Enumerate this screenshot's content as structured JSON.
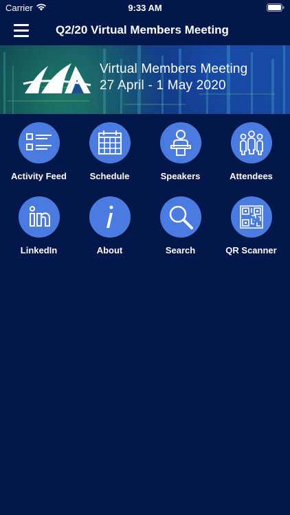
{
  "status_bar": {
    "carrier": "Carrier",
    "time": "9:33 AM"
  },
  "nav": {
    "title": "Q2/20 Virtual Members Meeting"
  },
  "banner": {
    "line1": "Virtual Members Meeting",
    "line2": "27 April - 1 May 2020"
  },
  "tiles": [
    {
      "label": "Activity Feed",
      "icon": "list-icon"
    },
    {
      "label": "Schedule",
      "icon": "calendar-icon"
    },
    {
      "label": "Speakers",
      "icon": "speaker-icon"
    },
    {
      "label": "Attendees",
      "icon": "people-icon"
    },
    {
      "label": "LinkedIn",
      "icon": "linkedin-icon"
    },
    {
      "label": "About",
      "icon": "info-icon"
    },
    {
      "label": "Search",
      "icon": "search-icon"
    },
    {
      "label": "QR Scanner",
      "icon": "qr-code-icon"
    }
  ],
  "colors": {
    "background": "#03174a",
    "tile_circle": "#4a7be0",
    "text": "#ffffff"
  }
}
